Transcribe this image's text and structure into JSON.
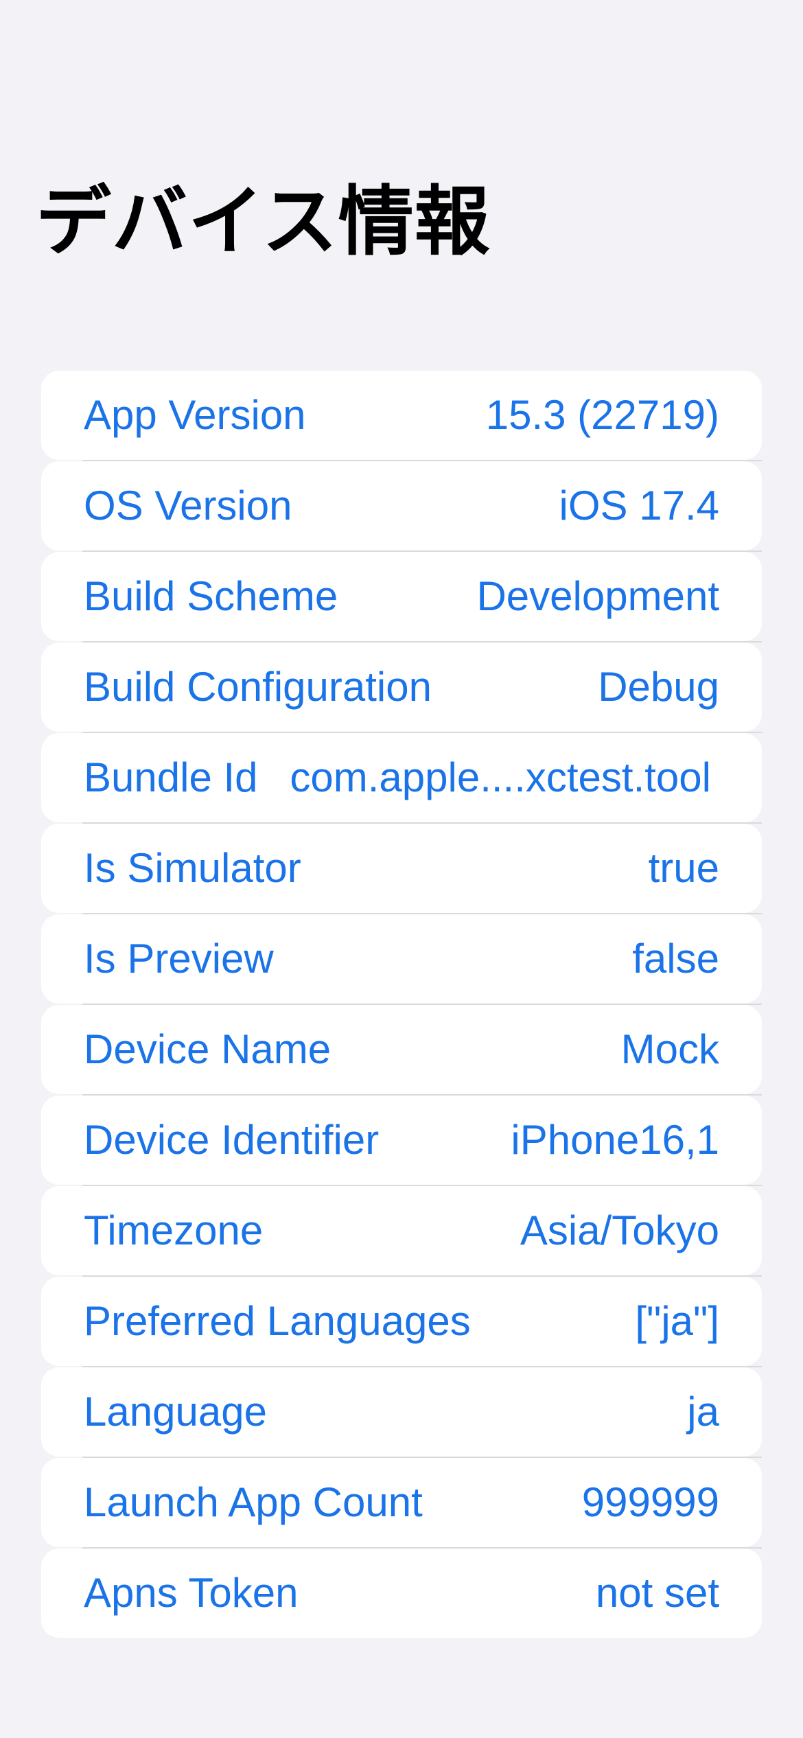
{
  "screen": {
    "title": "デバイス情報"
  },
  "colors": {
    "background": "#f2f2f7",
    "card": "#ffffff",
    "accent": "#1a73e8",
    "separator": "#d9d9de"
  },
  "rows": [
    {
      "label": "App Version",
      "value": "15.3 (22719)"
    },
    {
      "label": "OS Version",
      "value": "iOS 17.4"
    },
    {
      "label": "Build Scheme",
      "value": "Development"
    },
    {
      "label": "Build Configuration",
      "value": "Debug"
    },
    {
      "label": "Bundle Id",
      "value": "com.apple....xctest.tool"
    },
    {
      "label": "Is Simulator",
      "value": "true"
    },
    {
      "label": "Is Preview",
      "value": "false"
    },
    {
      "label": "Device Name",
      "value": "Mock"
    },
    {
      "label": "Device Identifier",
      "value": "iPhone16,1"
    },
    {
      "label": "Timezone",
      "value": "Asia/Tokyo"
    },
    {
      "label": "Preferred Languages",
      "value": "[\"ja\"]"
    },
    {
      "label": "Language",
      "value": "ja"
    },
    {
      "label": "Launch App Count",
      "value": "999999"
    },
    {
      "label": "Apns Token",
      "value": "not set"
    }
  ]
}
